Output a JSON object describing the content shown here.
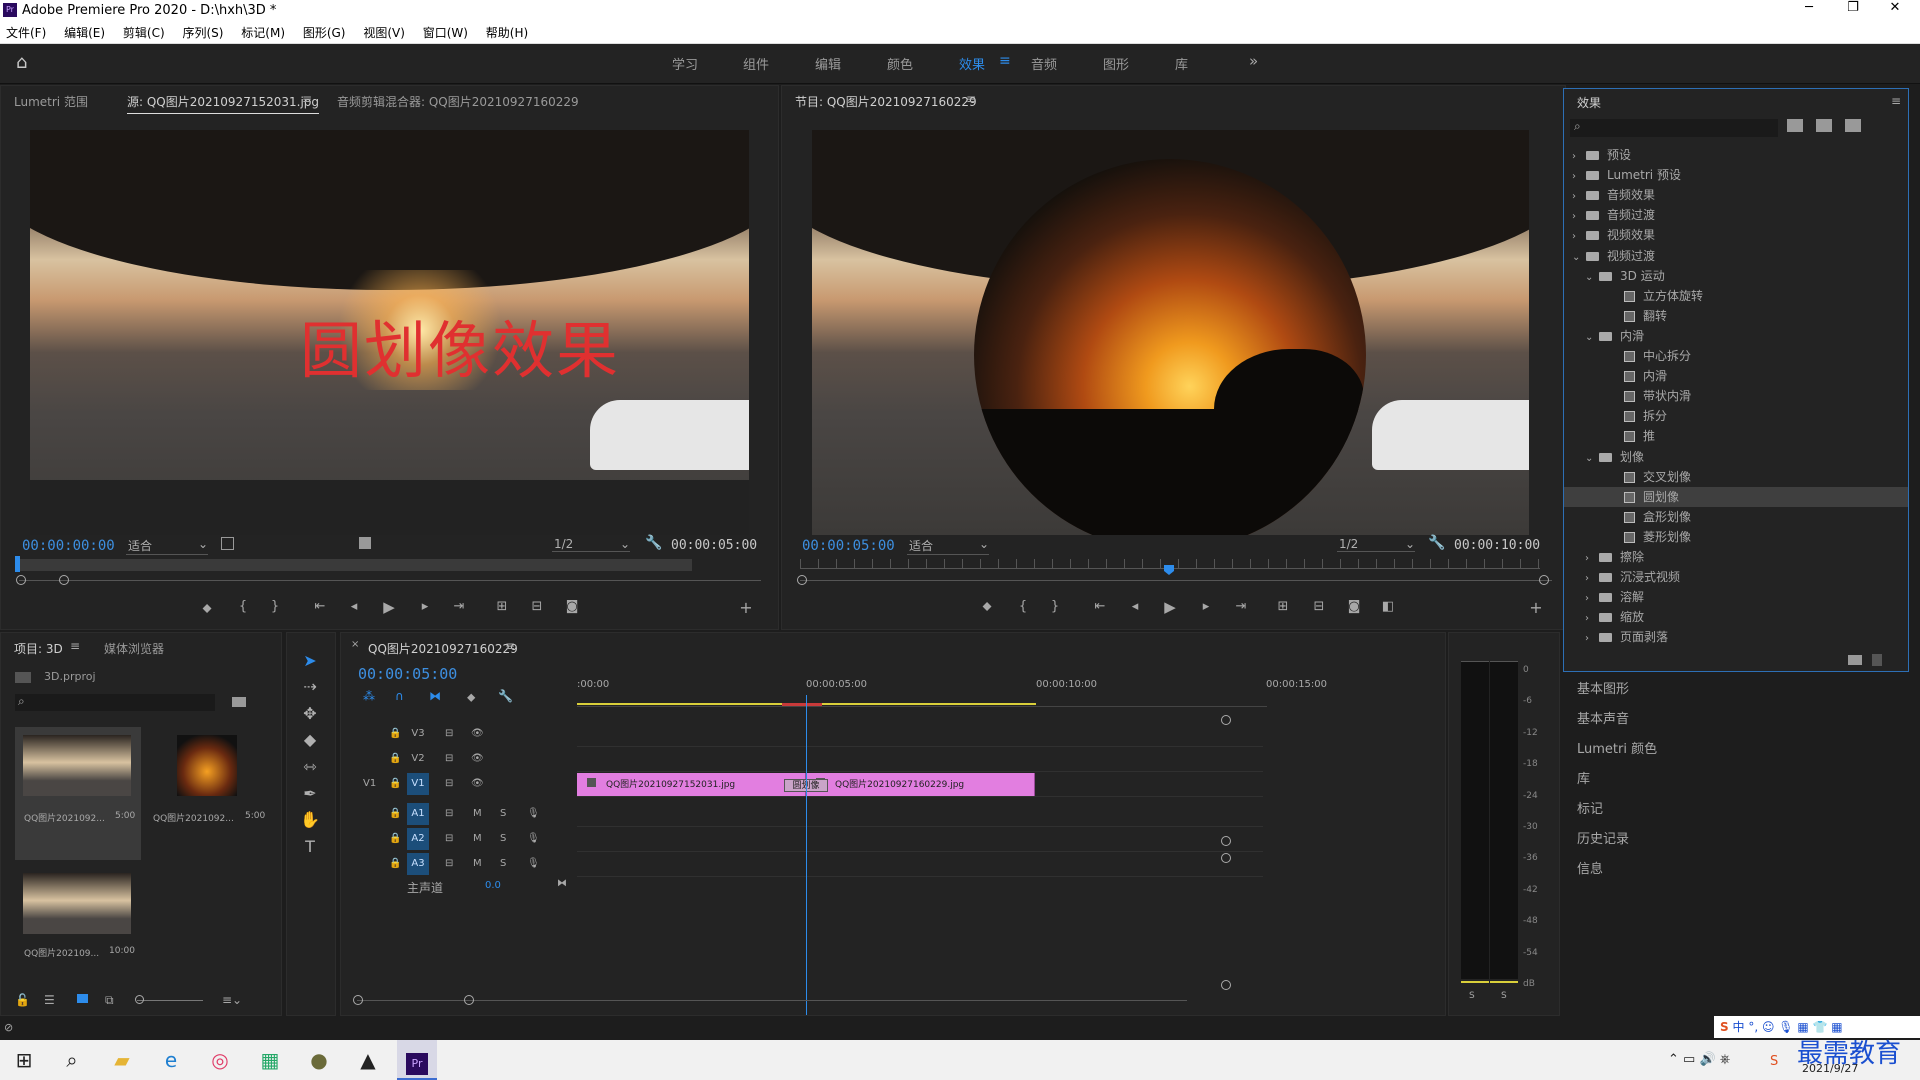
{
  "window": {
    "title": "Adobe Premiere Pro 2020 - D:\\hxh\\3D *",
    "app_icon": "Pr"
  },
  "menu": [
    "文件(F)",
    "编辑(E)",
    "剪辑(C)",
    "序列(S)",
    "标记(M)",
    "图形(G)",
    "视图(V)",
    "窗口(W)",
    "帮助(H)"
  ],
  "workspaces": [
    "学习",
    "组件",
    "编辑",
    "颜色",
    "效果",
    "音频",
    "图形",
    "库"
  ],
  "active_workspace": "效果",
  "source_panel": {
    "tabs": [
      "Lumetri 范围",
      "源: QQ图片20210927152031.jpg",
      "音频剪辑混合器: QQ图片20210927160229"
    ],
    "overlay_text": "圆划像效果",
    "timecode_in": "00:00:00:00",
    "fit": "适合",
    "resolution": "1/2",
    "duration": "00:00:05:00"
  },
  "program_panel": {
    "tab": "节目: QQ图片20210927160229",
    "timecode_in": "00:00:05:00",
    "fit": "适合",
    "resolution": "1/2",
    "duration": "00:00:10:00"
  },
  "effects_panel": {
    "title": "效果",
    "tree": [
      {
        "label": "预设",
        "level": 0,
        "kind": "folder",
        "open": false
      },
      {
        "label": "Lumetri 预设",
        "level": 0,
        "kind": "folder",
        "open": false
      },
      {
        "label": "音频效果",
        "level": 0,
        "kind": "folder",
        "open": false
      },
      {
        "label": "音频过渡",
        "level": 0,
        "kind": "folder",
        "open": false
      },
      {
        "label": "视频效果",
        "level": 0,
        "kind": "folder",
        "open": false
      },
      {
        "label": "视频过渡",
        "level": 0,
        "kind": "folder",
        "open": true
      },
      {
        "label": "3D 运动",
        "level": 1,
        "kind": "folder",
        "open": true
      },
      {
        "label": "立方体旋转",
        "level": 2,
        "kind": "fx"
      },
      {
        "label": "翻转",
        "level": 2,
        "kind": "fx"
      },
      {
        "label": "内滑",
        "level": 1,
        "kind": "folder",
        "open": true
      },
      {
        "label": "中心拆分",
        "level": 2,
        "kind": "fx"
      },
      {
        "label": "内滑",
        "level": 2,
        "kind": "fx"
      },
      {
        "label": "带状内滑",
        "level": 2,
        "kind": "fx"
      },
      {
        "label": "拆分",
        "level": 2,
        "kind": "fx"
      },
      {
        "label": "推",
        "level": 2,
        "kind": "fx"
      },
      {
        "label": "划像",
        "level": 1,
        "kind": "folder",
        "open": true
      },
      {
        "label": "交叉划像",
        "level": 2,
        "kind": "fx"
      },
      {
        "label": "圆划像",
        "level": 2,
        "kind": "fx",
        "selected": true
      },
      {
        "label": "盒形划像",
        "level": 2,
        "kind": "fx"
      },
      {
        "label": "菱形划像",
        "level": 2,
        "kind": "fx"
      },
      {
        "label": "擦除",
        "level": 1,
        "kind": "folder",
        "open": false
      },
      {
        "label": "沉浸式视频",
        "level": 1,
        "kind": "folder",
        "open": false
      },
      {
        "label": "溶解",
        "level": 1,
        "kind": "folder",
        "open": false
      },
      {
        "label": "缩放",
        "level": 1,
        "kind": "folder",
        "open": false
      },
      {
        "label": "页面剥落",
        "level": 1,
        "kind": "folder",
        "open": false
      }
    ]
  },
  "right_panels": [
    "基本图形",
    "基本声音",
    "Lumetri 颜色",
    "库",
    "标记",
    "历史记录",
    "信息"
  ],
  "project_panel": {
    "tabs": [
      "项目: 3D",
      "媒体浏览器"
    ],
    "file": "3D.prproj",
    "items": [
      {
        "name": "QQ图片2021092...",
        "duration": "5:00"
      },
      {
        "name": "QQ图片2021092...",
        "duration": "5:00"
      },
      {
        "name": "QQ图片202109...",
        "duration": "10:00"
      }
    ]
  },
  "timeline": {
    "tab": "QQ图片20210927160229",
    "timecode": "00:00:05:00",
    "ruler": [
      ":00:00",
      "00:00:05:00",
      "00:00:10:00",
      "00:00:15:00"
    ],
    "tracks": [
      "V3",
      "V2",
      "V1",
      "A1",
      "A2",
      "A3"
    ],
    "master": "主声道",
    "master_value": "0.0",
    "clips": [
      {
        "name": "QQ图片20210927152031.jpg"
      },
      {
        "name": "QQ图片20210927160229.jpg"
      }
    ],
    "transition_label": "圆划像",
    "playhead_fraction": 0.333
  },
  "audio_meter": {
    "levels": [
      "0",
      "-6",
      "-12",
      "-18",
      "-24",
      "-30",
      "-36",
      "-42",
      "-48",
      "-54",
      "dB"
    ],
    "solo": [
      "S",
      "S"
    ]
  },
  "taskbar": {
    "date": "2021/9/27",
    "watermark": "最需教育",
    "ime": "中"
  },
  "colors": {
    "accent": "#2d8ceb",
    "clip": "#e27ee0",
    "timecode": "#3d8fe0"
  }
}
